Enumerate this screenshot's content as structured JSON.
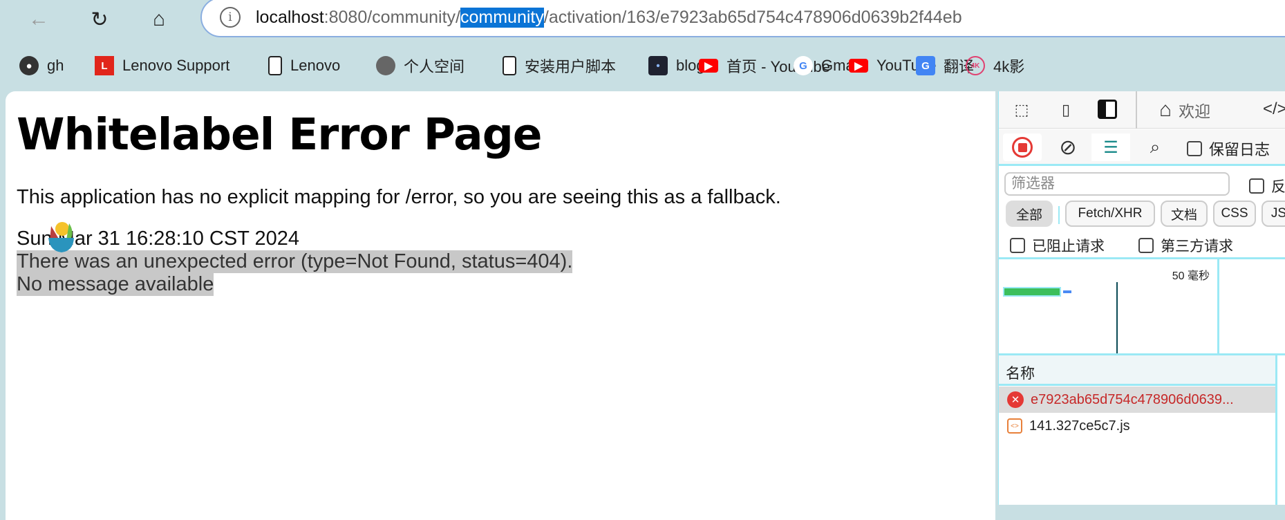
{
  "browser": {
    "url": {
      "host": "localhost",
      "pre": ":8080/community/",
      "selected": "community",
      "post": "/activation/163/e7923ab65d754c478906d0639b2f44eb"
    },
    "bookmarks": [
      {
        "label": "gh",
        "icon": "github-icon"
      },
      {
        "label": "Lenovo Support",
        "icon": "lenovo-l-icon"
      },
      {
        "label": "Lenovo",
        "icon": "document-icon"
      },
      {
        "label": "个人空间",
        "icon": "globe-icon"
      },
      {
        "label": "安装用户脚本",
        "icon": "document-icon"
      },
      {
        "label": "blog",
        "icon": "blog-icon"
      },
      {
        "label": "首页 - YouTube",
        "icon": "youtube-icon"
      },
      {
        "label": "Gmail",
        "icon": "google-icon"
      },
      {
        "label": "YouTube",
        "icon": "youtube-icon"
      },
      {
        "label": "翻译",
        "icon": "translate-icon"
      },
      {
        "label": "4k影",
        "icon": "4k-icon"
      }
    ]
  },
  "page": {
    "title": "Whitelabel Error Page",
    "description": "This application has no explicit mapping for /error, so you are seeing this as a fallback.",
    "timestamp": "Sun Mar 31 16:28:10 CST 2024",
    "error": "There was an unexpected error (type=Not Found, status=404).",
    "message": "No message available"
  },
  "devtools": {
    "welcome_tab": "欢迎",
    "preserve_log": "保留日志",
    "filter_placeholder": "筛选器",
    "invert": "反",
    "chips": [
      "全部",
      "Fetch/XHR",
      "文档",
      "CSS",
      "JS"
    ],
    "blocked_requests": "已阻止请求",
    "third_party": "第三方请求",
    "timeline_label": "50 毫秒",
    "name_header": "名称",
    "requests": [
      {
        "name": "e7923ab65d754c478906d0639...",
        "status": "error"
      },
      {
        "name": "141.327ce5c7.js",
        "status": "ok"
      }
    ],
    "colors": {
      "error": "#d32f2f",
      "accent": "#9be9f5"
    }
  }
}
